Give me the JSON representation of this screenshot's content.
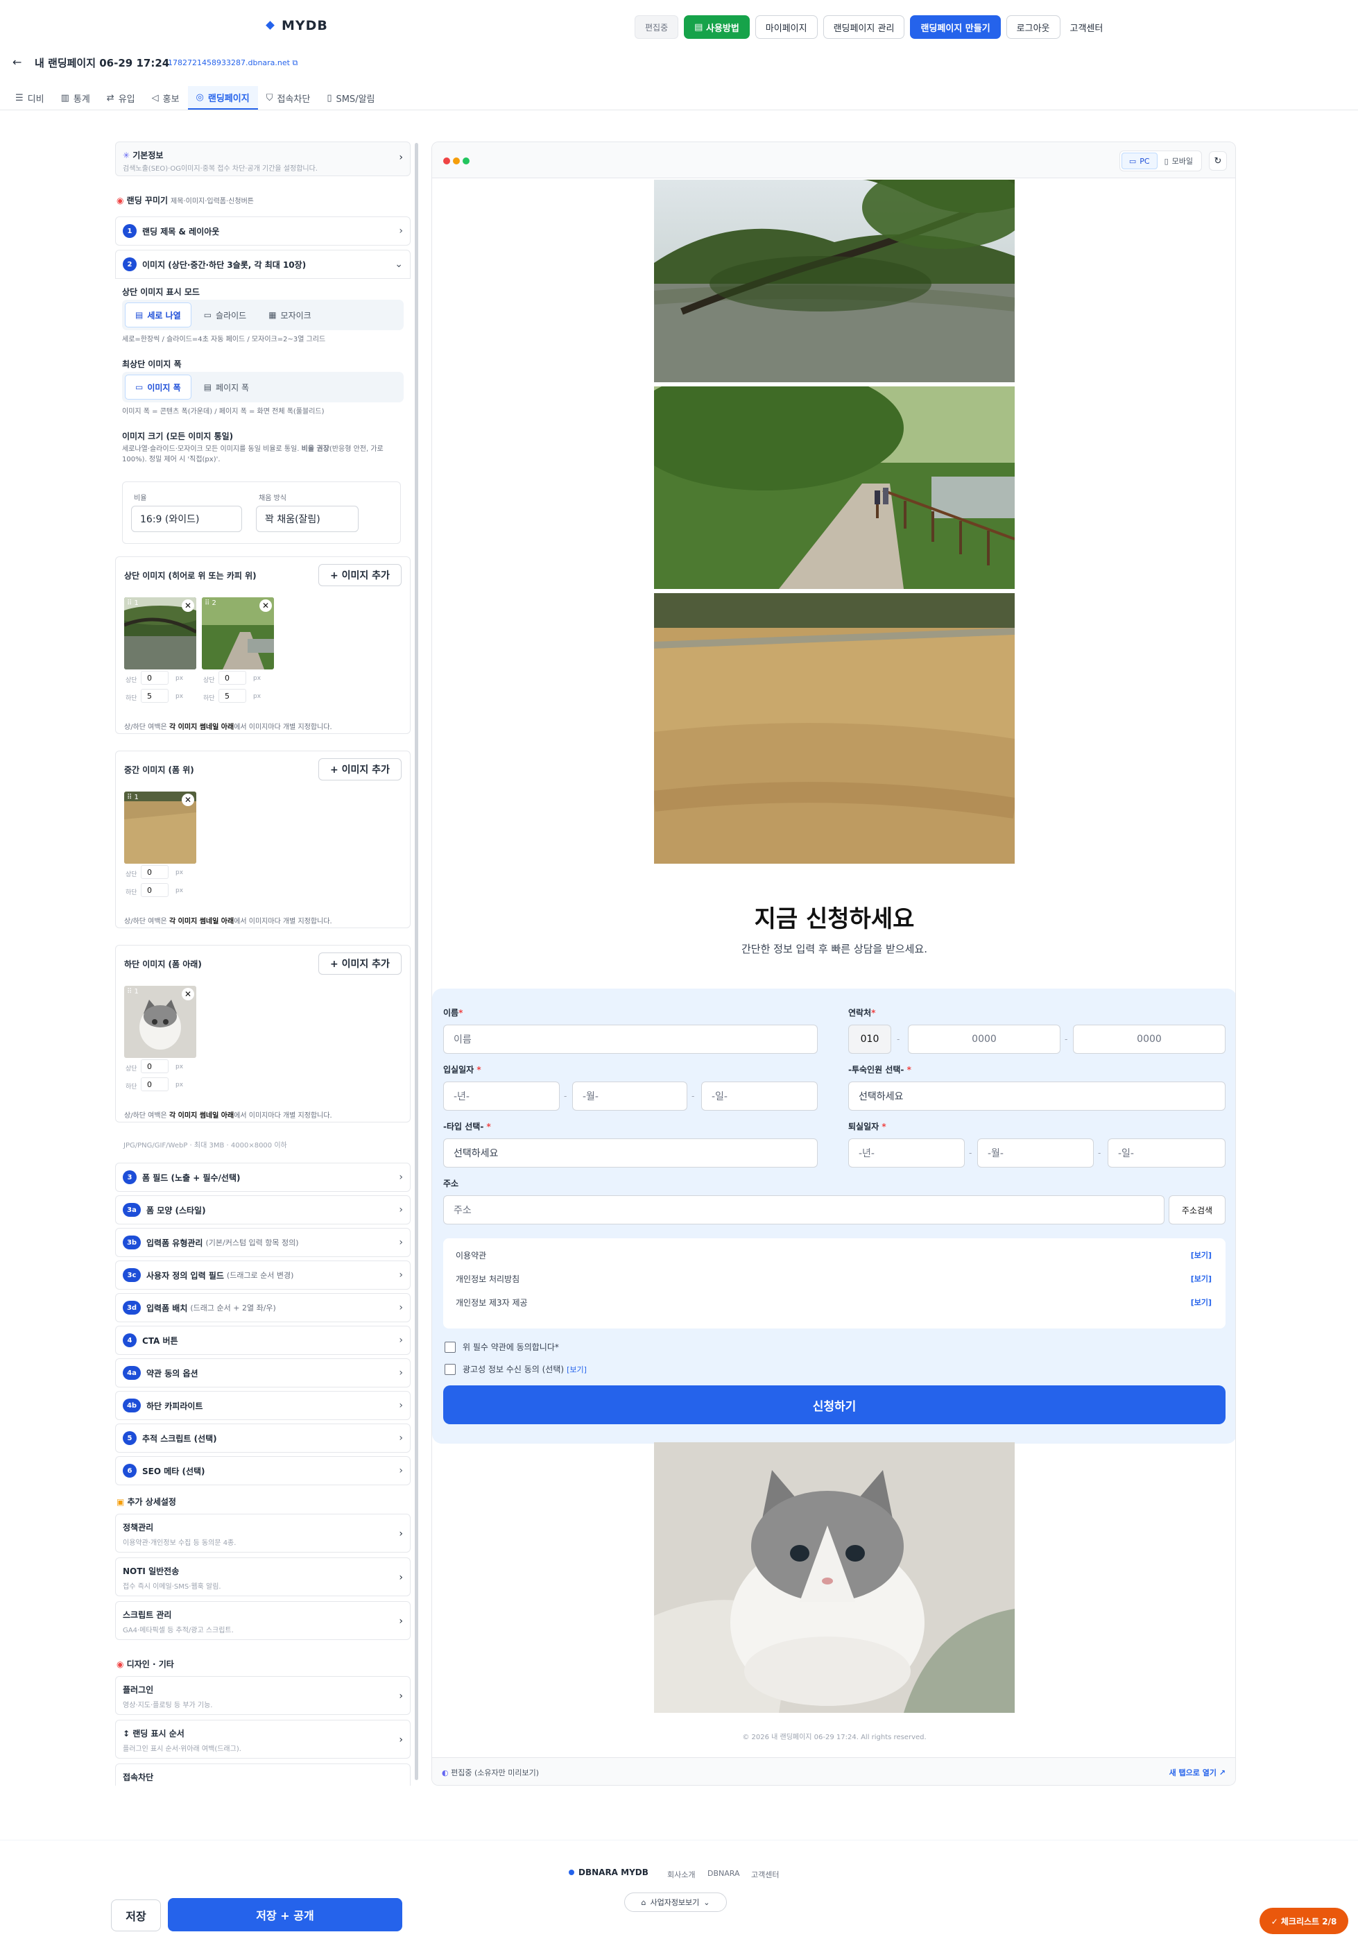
{
  "header": {
    "logo": "MYDB",
    "edit_badge": "편집중",
    "howto": "사용방법",
    "mypage": "마이페이지",
    "manage": "랜딩페이지 관리",
    "make": "랜딩페이지 만들기",
    "logout": "로그아웃",
    "support": "고객센터"
  },
  "page": {
    "back": "←",
    "title": "내 랜딩페이지 06-29 17:24",
    "link": "1782721458933287.dbnara.net"
  },
  "tabs": [
    {
      "label": "디비",
      "icon": "db-icon"
    },
    {
      "label": "통계",
      "icon": "chart-icon"
    },
    {
      "label": "유입",
      "icon": "share-icon"
    },
    {
      "label": "홍보",
      "icon": "megaphone-icon"
    },
    {
      "label": "랜딩페이지",
      "icon": "globe-icon"
    },
    {
      "label": "접속차단",
      "icon": "shield-icon"
    },
    {
      "label": "SMS/알림",
      "icon": "phone-icon"
    }
  ],
  "left": {
    "basic": {
      "title": "기본정보",
      "sub": "검색노출(SEO)·OG이미지·중복 접수 차단·공개 기간을 설정합니다."
    },
    "deco": {
      "title": "랜딩 꾸미기",
      "sub": "제목·이미지·입력폼·신청버튼"
    },
    "items": {
      "s1": {
        "num": "1",
        "label": "랜딩 제목 & 레이아웃"
      },
      "s2": {
        "num": "2",
        "label": "이미지 (상단·중간·하단 3슬롯, 각 최대 10장)"
      }
    },
    "topmode": {
      "label": "상단 이미지 표시 모드",
      "opts": [
        "세로 나열",
        "슬라이드",
        "모자이크"
      ],
      "hint": "세로=한장씩 / 슬라이드=4초 자동 페이드 / 모자이크=2~3열 그리드"
    },
    "topwidth": {
      "label": "최상단 이미지 폭",
      "opts": [
        "이미지 폭",
        "페이지 폭"
      ],
      "hint": "이미지 폭 = 콘텐츠 폭(가운데) / 페이지 폭 = 화면 전체 폭(풀블리드)"
    },
    "size": {
      "label": "이미지 크기 (모든 이미지 통일)",
      "hint1": "세로나열·슬라이드·모자이크 모든 이미지를 동일 비율로 통일.",
      "hint_bold": "비율 권장",
      "hint2": "(반응형 안전, 가로 100%). 정밀 제어 시 '직접(px)'.",
      "ratio_cap": "비율",
      "ratio": "16:9 (와이드)",
      "fill_cap": "채움 방식",
      "fill": "꽉 채움(잘림)"
    },
    "groups": {
      "top": {
        "title": "상단 이미지 (히어로 위 또는 카피 위)",
        "add": "+ 이미지 추가",
        "imgs": [
          {
            "n": "⠿ 1"
          },
          {
            "n": "⠿ 2"
          }
        ]
      },
      "mid": {
        "title": "중간 이미지 (폼 위)",
        "add": "+ 이미지 추가",
        "imgs": [
          {
            "n": "⠿ 1"
          }
        ]
      },
      "bot": {
        "title": "하단 이미지 (폼 아래)",
        "add": "+ 이미지 추가",
        "imgs": [
          {
            "n": "⠿ 1"
          }
        ]
      }
    },
    "pad": {
      "top": "상단",
      "bottom": "하단",
      "unit": "px",
      "v0": "0",
      "v5": "5"
    },
    "foot1": "상/하단 여백은",
    "foot_b": "각 이미지 썸네일 아래",
    "foot2": "에서 이미지마다 개별 지정합니다.",
    "format": "JPG/PNG/GIF/WebP · 최대 3MB · 4000×8000 이하",
    "rows": [
      {
        "num": "3",
        "label": "폼 필드 (노출 + 필수/선택)",
        "sub": ""
      },
      {
        "num": "3a",
        "label": "폼 모양 (스타일)",
        "sub": ""
      },
      {
        "num": "3b",
        "label": "입력폼 유형관리",
        "sub": "(기본/커스텀 입력 항목 정의)"
      },
      {
        "num": "3c",
        "label": "사용자 정의 입력 필드",
        "sub": "(드래그로 순서 변경)"
      },
      {
        "num": "3d",
        "label": "입력폼 배치",
        "sub": "(드래그 순서 + 2열 좌/우)"
      },
      {
        "num": "4",
        "label": "CTA 버튼",
        "sub": ""
      },
      {
        "num": "4a",
        "label": "약관 동의 옵션",
        "sub": ""
      },
      {
        "num": "4b",
        "label": "하단 카피라이트",
        "sub": ""
      },
      {
        "num": "5",
        "label": "추적 스크립트 (선택)",
        "sub": ""
      },
      {
        "num": "6",
        "label": "SEO 메타 (선택)",
        "sub": ""
      }
    ],
    "extra": {
      "title": "추가 상세설정",
      "cards": [
        {
          "t": "정책관리",
          "s": "이용약관·개인정보 수집 등 동의문 4종."
        },
        {
          "t": "NOTI 일반전송",
          "s": "접수 즉시 이메일·SMS·웹훅 알림."
        },
        {
          "t": "스크립트 관리",
          "s": "GA4·메타픽셀 등 추적/광고 스크립트."
        }
      ]
    },
    "design": {
      "title": "디자인 · 기타",
      "cards": [
        {
          "t": "플러그인",
          "s": "영상·지도·플로팅 등 부가 기능."
        },
        {
          "t": "↕ 랜딩 표시 순서",
          "s": "플러그인 표시 순서·위아래 여백(드래그)."
        },
        {
          "t": "접속차단",
          "s": ""
        }
      ]
    }
  },
  "preview": {
    "devices": {
      "pc": "PC",
      "mobile": "모바일"
    },
    "hero_title": "지금 신청하세요",
    "hero_sub": "간단한 정보 입력 후 빠른 상담을 받으세요.",
    "form": {
      "name": "이름",
      "name_ph": "이름",
      "phone": "연락처",
      "phone1": "010",
      "phone2": "0000",
      "phone3": "0000",
      "checkin": "입실일자",
      "checkout": "퇴실일자",
      "year": "-년-",
      "month": "-월-",
      "day": "-일-",
      "guests": "-투숙인원 선택-",
      "guests_ph": "선택하세요",
      "type": "-타입 선택-",
      "type_ph": "선택하세요",
      "addr": "주소",
      "addr_ph": "주소",
      "addr_btn": "주소검색",
      "terms": [
        {
          "t": "이용약관",
          "v": "[보기]"
        },
        {
          "t": "개인정보 처리방침",
          "v": "[보기]"
        },
        {
          "t": "개인정보 제3자 제공",
          "v": "[보기]"
        }
      ],
      "agree": "위 필수 약관에 동의합니다*",
      "ad": "광고성 정보 수신 동의 (선택)",
      "ad_v": "[보기]",
      "submit": "신청하기"
    },
    "copyright": "© 2026 내 랜딩페이지 06-29 17:24. All rights reserved.",
    "foot_left": "편집중 (소유자만 미리보기)",
    "foot_right": "새 탭으로 열기 ↗"
  },
  "footer": {
    "brand": "DBNARA MYDB",
    "links": [
      "회사소개",
      "DBNARA",
      "고객센터"
    ],
    "biz": "사업자정보보기"
  },
  "actions": {
    "save": "저장",
    "publish": "저장 + 공개",
    "checklist": "✓ 체크리스트 2/8"
  },
  "colors": {
    "primary": "#2563eb",
    "green": "#16a34a",
    "orange": "#ea580c"
  }
}
